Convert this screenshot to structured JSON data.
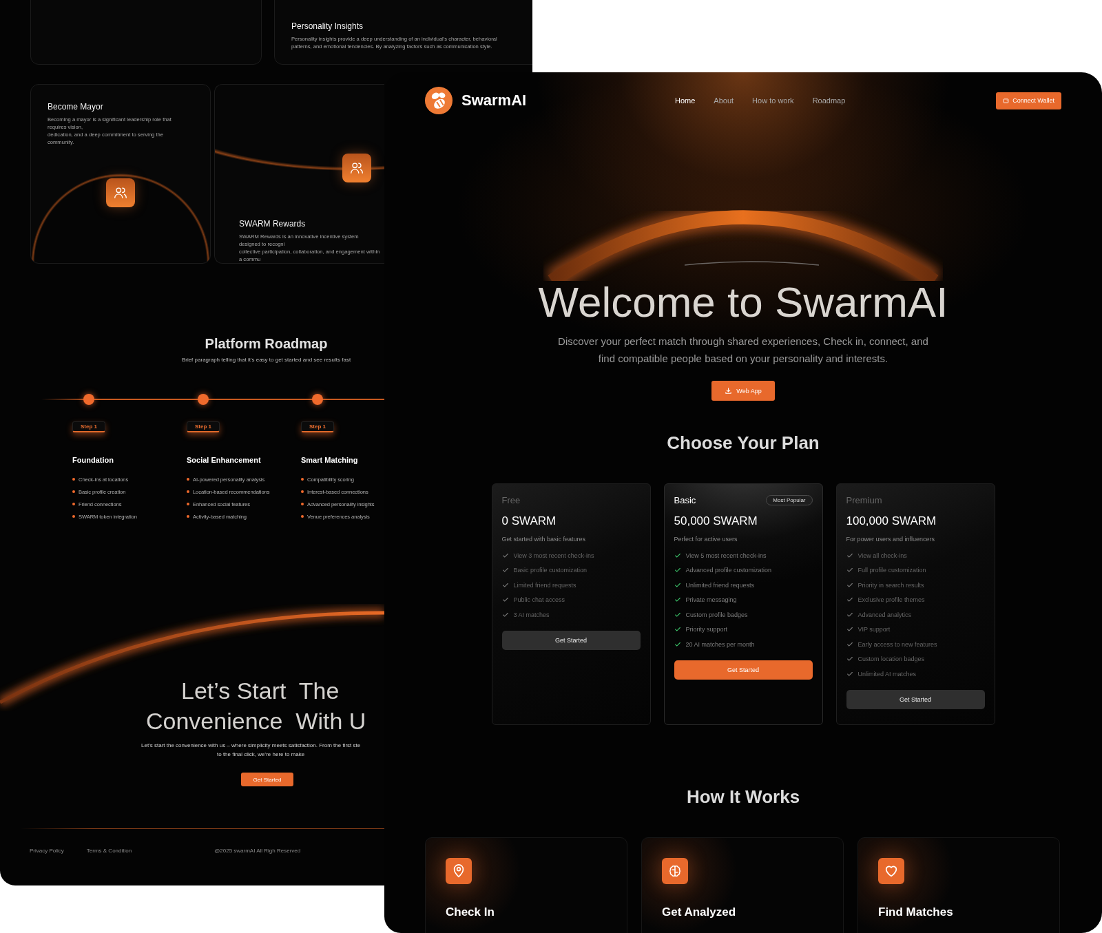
{
  "back_page": {
    "feature_cards": [
      {
        "title": "Personality Insights",
        "description_lines": [
          "Personality insights provide a deep understanding of an individual's character, behavioral",
          "patterns, and emotional tendencies. By analyzing factors such as communication style."
        ]
      },
      {
        "title": "Become Mayor",
        "description_lines": [
          "Becoming a mayor is a significant leadership role that requires vision,",
          "dedication, and a deep commitment to serving the community."
        ]
      },
      {
        "title": "SWARM Rewards",
        "description_lines": [
          "SWARM Rewards is an innovative incentive system designed to recogni",
          "collective participation, collaboration, and engagement within a commu"
        ]
      }
    ],
    "roadmap": {
      "title": "Platform Roadmap",
      "subtitle": "Brief paragraph telling that it's easy to get started and see results fast",
      "steps": [
        {
          "badge": "Step 1",
          "title": "Foundation",
          "items": [
            "Check-ins at locations",
            "Basic profile creation",
            "Friend connections",
            "SWARM token integration"
          ]
        },
        {
          "badge": "Step 1",
          "title": "Social Enhancement",
          "items": [
            "AI-powered personality analysis",
            "Location-based recommendations",
            "Enhanced social features",
            "Activity-based matching"
          ]
        },
        {
          "badge": "Step 1",
          "title": "Smart Matching",
          "items": [
            "Compatibility scoring",
            "Interest-based connections",
            "Advanced personality insights",
            "Venue preferences analysis"
          ]
        }
      ]
    },
    "cta": {
      "title_lines": [
        "Let’s Start  The",
        "Convenience  With U"
      ],
      "text_lines": [
        "Let’s start the convenience with us – where simplicity meets satisfaction. From the first ste",
        "to the final click, we’re here to make"
      ],
      "button": "Get Started"
    },
    "footer": {
      "links": [
        "Privacy Policy",
        "Terms & Condition"
      ],
      "copyright": "@2025 swarmAI All Righ Reserved"
    }
  },
  "front_page": {
    "brand": "SwarmAI",
    "nav": [
      {
        "label": "Home",
        "selected": true
      },
      {
        "label": "About",
        "selected": false
      },
      {
        "label": "How to work",
        "selected": false
      },
      {
        "label": "Roadmap",
        "selected": false
      }
    ],
    "connect_button": "Connect Wallet",
    "hero": {
      "title": "Welcome to SwarmAI",
      "subtitle_lines": [
        "Discover your perfect match through shared experiences, Check in, connect, and",
        "find compatible people based on your personality and interests."
      ],
      "button": "Web App"
    },
    "plans": {
      "title": "Choose Your Plan",
      "items": [
        {
          "name": "Free",
          "price": "0 SWARM",
          "description": "Get started with basic features",
          "featured": false,
          "features": [
            "View 3 most recent check-ins",
            "Basic profile customization",
            "Limited friend requests",
            "Public chat access",
            "3 AI matches"
          ],
          "button": "Get Started"
        },
        {
          "name": "Basic",
          "badge": "Most Popular",
          "price": "50,000 SWARM",
          "description": "Perfect for active users",
          "featured": true,
          "features": [
            "View 5 most recent check-ins",
            "Advanced profile customization",
            "Unlimited friend requests",
            "Private messaging",
            "Custom profile badges",
            "Priority support",
            "20 AI matches per month"
          ],
          "button": "Get Started"
        },
        {
          "name": "Premium",
          "price": "100,000 SWARM",
          "description": "For power users and influencers",
          "featured": false,
          "features": [
            "View all check-ins",
            "Full profile customization",
            "Priority in search results",
            "Exclusive profile themes",
            "Advanced analytics",
            "VIP support",
            "Early access to new features",
            "Custom location badges",
            "Unlimited AI matches"
          ],
          "button": "Get Started"
        }
      ]
    },
    "how_it_works": {
      "title": "How It Works",
      "steps": [
        {
          "title": "Check In"
        },
        {
          "title": "Get Analyzed"
        },
        {
          "title": "Find Matches"
        }
      ]
    }
  }
}
